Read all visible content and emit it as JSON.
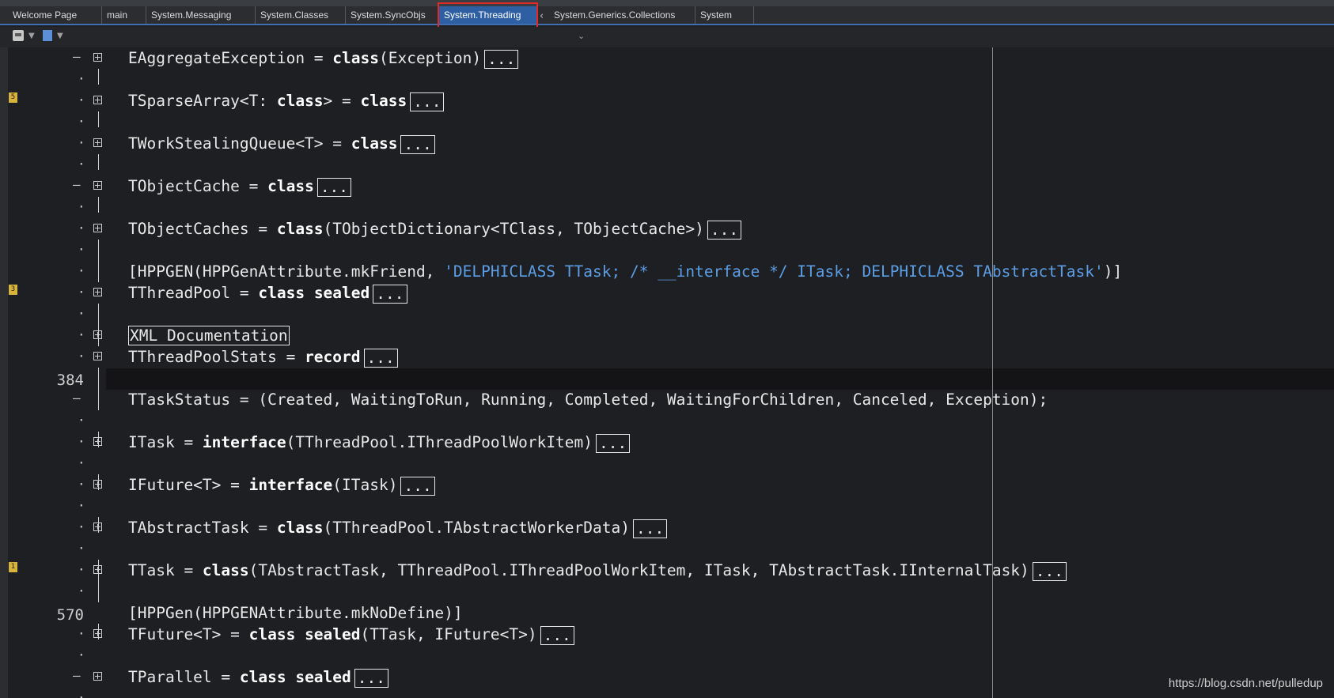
{
  "tabs": [
    {
      "label": "Welcome Page",
      "active": false
    },
    {
      "label": "main",
      "active": false
    },
    {
      "label": "System.Messaging",
      "active": false
    },
    {
      "label": "System.Classes",
      "active": false
    },
    {
      "label": "System.SyncObjs",
      "active": false
    },
    {
      "label": "System.Threading",
      "active": true
    },
    {
      "label": "System.Generics.Collections",
      "active": false
    },
    {
      "label": "System",
      "active": false
    }
  ],
  "editor": {
    "current_line_number": "384",
    "line_570": "570",
    "bookmarks": {
      "b5": "5",
      "b3": "3",
      "b1": "1"
    },
    "collapsed_marker": "...",
    "lines": {
      "l1": {
        "name": "EAggregateException = ",
        "kw": "class",
        "rest": "(Exception)"
      },
      "l2": {
        "name": "TSparseArray<T: ",
        "kw": "class",
        "mid": "> = ",
        "kw2": "class"
      },
      "l3": {
        "name": "TWorkStealingQueue<T> = ",
        "kw": "class"
      },
      "l4": {
        "name": "TObjectCache = ",
        "kw": "class"
      },
      "l5": {
        "name": "TObjectCaches = ",
        "kw": "class",
        "rest": "(TObjectDictionary<TClass, TObjectCache>)"
      },
      "l6": {
        "pre": "[HPPGEN(HPPGenAttribute.mkFriend, ",
        "str": "'DELPHICLASS TTask; /* __interface */ ITask; DELPHICLASS TAbstractTask'",
        "post": ")]"
      },
      "l7": {
        "name": "TThreadPool = ",
        "kw": "class sealed"
      },
      "l8": {
        "text": "XML Documentation"
      },
      "l9": {
        "name": "TThreadPoolStats = ",
        "kw": "record"
      },
      "l10": {
        "text": "TTaskStatus = (Created, WaitingToRun, Running, Completed, WaitingForChildren, Canceled, Exception);"
      },
      "l11": {
        "name": "ITask = ",
        "kw": "interface",
        "rest": "(TThreadPool.IThreadPoolWorkItem)"
      },
      "l12": {
        "name": "IFuture<T> = ",
        "kw": "interface",
        "rest": "(ITask)"
      },
      "l13": {
        "name": "TAbstractTask = ",
        "kw": "class",
        "rest": "(TThreadPool.TAbstractWorkerData)"
      },
      "l14": {
        "name": "TTask = ",
        "kw": "class",
        "rest": "(TAbstractTask, TThreadPool.IThreadPoolWorkItem, ITask, TAbstractTask.IInternalTask)"
      },
      "l15": {
        "text": "[HPPGen(HPPGENAttribute.mkNoDefine)]"
      },
      "l16": {
        "name": "TFuture<T> = ",
        "kw": "class sealed",
        "rest": "(TTask, IFuture<T>)"
      },
      "l17": {
        "name": "TParallel = ",
        "kw": "class sealed"
      }
    }
  },
  "watermark": "https://blog.csdn.net/pulledup",
  "colors": {
    "accent": "#2f5fa3",
    "highlight": "#e02a2a",
    "string": "#5b9ee6",
    "background": "#1e1f22"
  }
}
